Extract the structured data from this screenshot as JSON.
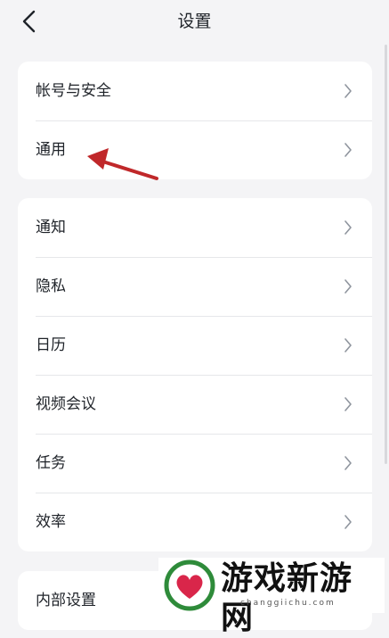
{
  "header": {
    "title": "设置"
  },
  "groups": [
    {
      "items": [
        "帐号与安全",
        "通用"
      ]
    },
    {
      "items": [
        "通知",
        "隐私",
        "日历",
        "视频会议",
        "任务",
        "效率"
      ]
    },
    {
      "items": [
        "内部设置"
      ]
    }
  ],
  "watermark": {
    "brand": "游戏新游网",
    "url": "changgiichu.com"
  },
  "colors": {
    "background": "#f4f4f6",
    "card": "#ffffff",
    "annotation_arrow": "#c0282a",
    "chevron": "#8f959e"
  },
  "icons": {
    "back": "chevron-left-icon",
    "row": "chevron-right-icon",
    "annotation": "arrow-annotation-icon"
  }
}
